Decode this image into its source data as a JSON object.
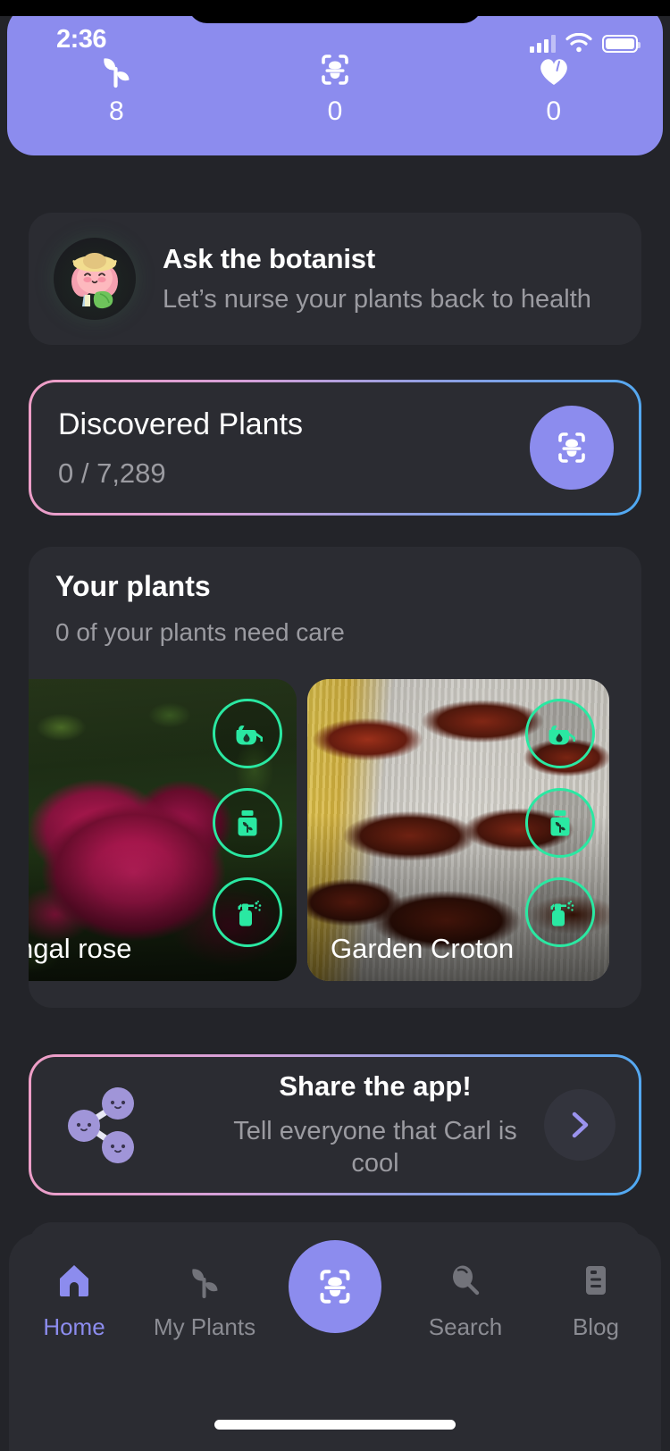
{
  "status_bar": {
    "time": "2:36",
    "signal_icon": "cellular-signal-icon",
    "wifi_icon": "wifi-icon",
    "battery_icon": "battery-icon"
  },
  "header": {
    "background_color": "#8c8cee",
    "stats": [
      {
        "icon": "seedling-icon",
        "value": "8",
        "name": "plants-count"
      },
      {
        "icon": "scan-leaf-icon",
        "value": "0",
        "name": "scans-count"
      },
      {
        "icon": "heart-icon",
        "value": "0",
        "name": "favorites-count"
      }
    ]
  },
  "botanist_card": {
    "avatar_icon": "botanist-avatar",
    "title": "Ask the botanist",
    "subtitle": "Let’s nurse your plants back to health"
  },
  "discovered_card": {
    "title": "Discovered Plants",
    "progress": "0 / 7,289",
    "scan_button_icon": "scan-leaf-icon",
    "border_gradient_from": "#ef9ec6",
    "border_gradient_to": "#4ea9f2",
    "accent_color": "#8c8cee"
  },
  "your_plants": {
    "title": "Your plants",
    "subtitle": "0 of your plants need care",
    "care_icon_color": "#2ae8a2",
    "plants": [
      {
        "name": "ngal rose",
        "photo": "red-rose-photo",
        "care_actions": [
          {
            "icon": "watering-can-icon",
            "label": "water"
          },
          {
            "icon": "fertilizer-bottle-icon",
            "label": "fertilize"
          },
          {
            "icon": "spray-bottle-icon",
            "label": "mist"
          }
        ]
      },
      {
        "name": "Garden Croton",
        "photo": "garden-croton-photo",
        "care_actions": [
          {
            "icon": "watering-can-icon",
            "label": "water"
          },
          {
            "icon": "fertilizer-bottle-icon",
            "label": "fertilize"
          },
          {
            "icon": "spray-bottle-icon",
            "label": "mist"
          }
        ]
      }
    ]
  },
  "share_card": {
    "icon": "share-network-icon",
    "title": "Share the app!",
    "subtitle": "Tell everyone that Carl is cool",
    "chevron_icon": "chevron-right-icon"
  },
  "bottom_nav": {
    "active": "Home",
    "items": [
      {
        "label": "Home",
        "icon": "home-icon"
      },
      {
        "label": "My Plants",
        "icon": "seedling-icon"
      },
      {
        "label": "",
        "icon": "scan-leaf-icon"
      },
      {
        "label": "Search",
        "icon": "magnifier-icon"
      },
      {
        "label": "Blog",
        "icon": "article-icon"
      }
    ]
  }
}
